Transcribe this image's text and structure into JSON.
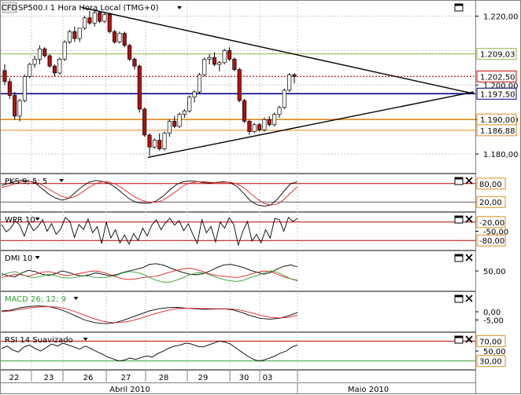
{
  "title": "SP500.I 1 Hora Hora Local (TMG+0)",
  "logo_text": "CFD",
  "colors": {
    "background": "#ffffff",
    "grid": "#c8c8c8",
    "candle_up": "#ffffff",
    "candle_down": "#b01010",
    "wick": "#000000",
    "green_level": "#8db840",
    "red_dotted": "#c00000",
    "blue_level": "#000090",
    "orange_level": "#e08a1a",
    "trendline": "#000000",
    "oscillator_black": "#000000",
    "oscillator_red": "#e02020",
    "oscillator_green": "#30a030",
    "box_orange": "#e08a1a"
  },
  "icons": {
    "window": "maximize-icon",
    "close": "close-icon",
    "dropdown": "dropdown-arrow-icon"
  },
  "main_panel": {
    "y_ticks": [
      "1.220,00",
      "1.200,00",
      "1.190,00",
      "1.180,00"
    ],
    "level_boxes": [
      {
        "name": "green",
        "label": "1.209,03",
        "value": 1209.03
      },
      {
        "name": "red",
        "label": "1.202,50",
        "value": 1202.5
      },
      {
        "name": "blue",
        "label": "1.197,50",
        "value": 1197.5
      },
      {
        "name": "orange1",
        "label": "1.190,00",
        "value": 1190.0
      },
      {
        "name": "orange2",
        "label": "1.186,88",
        "value": 1186.88
      }
    ]
  },
  "x_axis": {
    "day_labels": [
      "22",
      "23",
      "26",
      "27",
      "28",
      "29",
      "30",
      "03"
    ],
    "month_labels": [
      "Abril 2010",
      "Maio 2010"
    ]
  },
  "chart_data": [
    {
      "type": "candlestick",
      "title": "SP500.I 1 Hora Hora Local (TMG+0)",
      "ylim": [
        1175,
        1224
      ],
      "ohlc": [
        [
          1204.2,
          1206.0,
          1200.0,
          1201.0
        ],
        [
          1201.0,
          1202.0,
          1196.0,
          1197.0
        ],
        [
          1197.0,
          1198.0,
          1190.0,
          1191.0
        ],
        [
          1191.0,
          1196.0,
          1189.5,
          1195.5
        ],
        [
          1195.5,
          1203.0,
          1195.0,
          1202.5
        ],
        [
          1202.5,
          1206.5,
          1202.0,
          1206.0
        ],
        [
          1206.0,
          1208.5,
          1205.0,
          1207.5
        ],
        [
          1207.5,
          1211.5,
          1206.0,
          1210.5
        ],
        [
          1210.5,
          1211.0,
          1208.0,
          1208.5
        ],
        [
          1208.5,
          1209.0,
          1205.0,
          1205.5
        ],
        [
          1205.5,
          1206.0,
          1202.5,
          1203.5
        ],
        [
          1203.5,
          1208.0,
          1203.0,
          1207.5
        ],
        [
          1207.5,
          1213.0,
          1207.0,
          1212.5
        ],
        [
          1212.5,
          1216.0,
          1212.0,
          1215.5
        ],
        [
          1215.5,
          1217.0,
          1212.5,
          1213.5
        ],
        [
          1213.5,
          1216.5,
          1212.5,
          1216.5
        ],
        [
          1216.5,
          1220.0,
          1216.0,
          1219.5
        ],
        [
          1219.5,
          1221.5,
          1217.5,
          1218.0
        ],
        [
          1218.0,
          1221.5,
          1217.0,
          1221.0
        ],
        [
          1221.0,
          1221.5,
          1218.0,
          1218.5
        ],
        [
          1218.5,
          1221.0,
          1218.0,
          1220.5
        ],
        [
          1220.5,
          1221.0,
          1215.0,
          1215.5
        ],
        [
          1215.5,
          1216.0,
          1212.0,
          1212.5
        ],
        [
          1212.5,
          1215.5,
          1212.0,
          1215.0
        ],
        [
          1215.0,
          1215.5,
          1211.0,
          1211.5
        ],
        [
          1211.5,
          1212.0,
          1207.0,
          1207.5
        ],
        [
          1207.5,
          1208.0,
          1204.5,
          1205.5
        ],
        [
          1205.5,
          1206.0,
          1192.0,
          1193.0
        ],
        [
          1193.0,
          1193.5,
          1185.0,
          1185.5
        ],
        [
          1185.5,
          1186.0,
          1179.5,
          1182.0
        ],
        [
          1182.0,
          1184.5,
          1181.5,
          1184.0
        ],
        [
          1184.0,
          1186.0,
          1181.0,
          1181.5
        ],
        [
          1181.5,
          1186.5,
          1181.0,
          1186.0
        ],
        [
          1186.0,
          1190.0,
          1185.0,
          1189.5
        ],
        [
          1189.5,
          1191.0,
          1187.5,
          1188.0
        ],
        [
          1188.0,
          1192.0,
          1187.5,
          1191.5
        ],
        [
          1191.5,
          1193.0,
          1190.5,
          1192.5
        ],
        [
          1192.5,
          1197.0,
          1192.0,
          1196.5
        ],
        [
          1196.5,
          1198.5,
          1195.0,
          1198.0
        ],
        [
          1198.0,
          1203.5,
          1197.5,
          1203.0
        ],
        [
          1203.0,
          1208.0,
          1202.5,
          1207.5
        ],
        [
          1207.5,
          1209.0,
          1206.0,
          1208.0
        ],
        [
          1208.0,
          1209.5,
          1205.5,
          1206.0
        ],
        [
          1206.0,
          1207.0,
          1204.0,
          1206.5
        ],
        [
          1206.5,
          1210.5,
          1206.0,
          1210.0
        ],
        [
          1210.0,
          1211.0,
          1207.0,
          1207.5
        ],
        [
          1207.5,
          1208.0,
          1204.0,
          1204.5
        ],
        [
          1204.5,
          1205.0,
          1195.0,
          1195.5
        ],
        [
          1195.5,
          1196.0,
          1189.0,
          1189.5
        ],
        [
          1189.5,
          1190.0,
          1185.5,
          1186.5
        ],
        [
          1186.5,
          1189.0,
          1186.0,
          1188.5
        ],
        [
          1188.5,
          1189.0,
          1186.5,
          1187.0
        ],
        [
          1187.0,
          1190.5,
          1186.5,
          1190.0
        ],
        [
          1190.0,
          1191.0,
          1188.0,
          1188.5
        ],
        [
          1188.5,
          1192.0,
          1188.0,
          1191.5
        ],
        [
          1191.5,
          1194.0,
          1190.5,
          1193.5
        ],
        [
          1193.5,
          1199.0,
          1193.0,
          1198.5
        ],
        [
          1198.5,
          1203.5,
          1198.0,
          1203.0
        ],
        [
          1203.0,
          1203.5,
          1200.5,
          1202.5
        ]
      ],
      "horizontal_levels": [
        1209.03,
        1202.5,
        1197.5,
        1190.0,
        1186.88
      ],
      "trendlines": [
        {
          "from": [
            0.17,
            1222.5
          ],
          "to": [
            1.0,
            1197.5
          ]
        },
        {
          "from": [
            0.31,
            1179.0
          ],
          "to": [
            1.0,
            1198.0
          ]
        }
      ]
    },
    {
      "type": "line",
      "title": "PKS 9; 5; 5",
      "ylim": [
        0,
        100
      ],
      "y_ticks": [],
      "levels": [
        {
          "label": "80,00",
          "value": 80
        },
        {
          "label": "20,00",
          "value": 20
        }
      ],
      "series": [
        {
          "color": "black",
          "values": [
            74,
            80,
            87,
            91,
            88,
            82,
            64,
            46,
            33,
            26,
            32,
            52,
            70,
            85,
            90,
            87,
            80,
            67,
            48,
            30,
            19,
            16,
            16,
            23,
            39,
            59,
            77,
            86,
            89,
            87,
            83,
            82,
            84,
            86,
            83,
            71,
            48,
            24,
            11,
            6,
            10,
            29,
            56,
            80,
            86
          ]
        },
        {
          "color": "red",
          "values": [
            68,
            72,
            80,
            85,
            87,
            85,
            76,
            62,
            49,
            38,
            32,
            38,
            52,
            68,
            80,
            86,
            85,
            78,
            64,
            48,
            34,
            24,
            19,
            19,
            26,
            40,
            56,
            72,
            82,
            86,
            86,
            84,
            83,
            84,
            84,
            79,
            67,
            48,
            30,
            16,
            10,
            13,
            28,
            50,
            70
          ]
        }
      ]
    },
    {
      "type": "line",
      "title": "WPR 10",
      "ylim": [
        -100,
        0
      ],
      "y_ticks": [
        "-50,00"
      ],
      "levels": [
        {
          "label": "-20,00",
          "value": -20
        },
        {
          "label": "-80,00",
          "value": -80
        }
      ],
      "series": [
        {
          "color": "black",
          "values": [
            -28,
            -52,
            -40,
            -15,
            -30,
            -66,
            -22,
            -48,
            -35,
            -12,
            -50,
            -25,
            -60,
            -42,
            -5,
            -18,
            -70,
            -28,
            -44,
            -10,
            -55,
            -35,
            -90,
            -20,
            -72,
            -45,
            -88,
            -62,
            -92,
            -58,
            -80,
            -40,
            -65,
            -30,
            -12,
            -45,
            -22,
            -8,
            -30,
            -15,
            -48,
            -25,
            -60,
            -90,
            -12,
            -55,
            -34,
            -85,
            -20,
            -40,
            -6,
            -28,
            -95,
            -50,
            -18,
            -82,
            -60,
            -88,
            -45,
            -72,
            -8,
            -12,
            -50,
            -5,
            -18,
            -8
          ]
        }
      ]
    },
    {
      "type": "line",
      "title": "DMI 10",
      "ylim": [
        0,
        100
      ],
      "y_ticks": [
        "50,00"
      ],
      "series": [
        {
          "color": "black",
          "values": [
            42,
            35,
            32,
            44,
            52,
            48,
            40,
            36,
            42,
            50,
            45,
            38,
            34,
            38,
            44,
            40,
            36,
            38,
            45,
            50,
            55,
            60,
            70,
            72,
            68,
            60,
            52,
            45,
            40,
            38,
            42,
            50,
            60,
            68,
            70,
            66,
            60,
            52,
            46,
            40,
            45,
            56,
            64,
            68,
            62
          ]
        },
        {
          "color": "red",
          "values": [
            30,
            34,
            40,
            38,
            34,
            40,
            46,
            48,
            44,
            38,
            36,
            40,
            44,
            48,
            50,
            46,
            40,
            32,
            26,
            24,
            26,
            30,
            32,
            34,
            40,
            46,
            52,
            56,
            58,
            54,
            48,
            40,
            36,
            34,
            32,
            30,
            34,
            40,
            46,
            50,
            48,
            40,
            32,
            26,
            22
          ]
        },
        {
          "color": "green",
          "values": [
            36,
            44,
            48,
            40,
            32,
            30,
            34,
            40,
            36,
            30,
            28,
            30,
            36,
            34,
            30,
            30,
            32,
            36,
            44,
            48,
            46,
            40,
            30,
            22,
            16,
            16,
            22,
            30,
            38,
            44,
            44,
            38,
            30,
            24,
            20,
            18,
            22,
            30,
            36,
            44,
            50,
            46,
            36,
            26,
            20
          ]
        }
      ]
    },
    {
      "type": "line",
      "title": "MACD 26; 12; 9",
      "ylim": [
        -10,
        10
      ],
      "y_ticks": [
        "0,00",
        "-5,00"
      ],
      "series": [
        {
          "color": "black",
          "values": [
            0.5,
            1.0,
            2.4,
            3.2,
            3.5,
            3.2,
            2.0,
            0.0,
            -2.5,
            -5.0,
            -6.5,
            -7.2,
            -7.0,
            -5.5,
            -3.5,
            -1.5,
            0.5,
            1.8,
            2.5,
            2.6,
            2.2,
            1.8,
            1.5,
            1.6,
            1.8,
            1.2,
            -0.5,
            -2.5,
            -4.0,
            -4.5,
            -4.0,
            -2.5,
            -0.5
          ]
        },
        {
          "color": "red",
          "values": [
            0.0,
            0.5,
            1.5,
            2.3,
            2.9,
            3.1,
            2.8,
            1.8,
            0.0,
            -2.2,
            -4.2,
            -5.8,
            -6.6,
            -6.5,
            -5.5,
            -4.0,
            -2.2,
            -0.5,
            0.9,
            1.8,
            2.2,
            2.1,
            1.9,
            1.8,
            1.8,
            1.6,
            0.8,
            -0.6,
            -2.2,
            -3.4,
            -3.8,
            -3.4,
            -2.2
          ]
        }
      ]
    },
    {
      "type": "line",
      "title": "RSI 14 Suavizado",
      "ylim": [
        20,
        80
      ],
      "y_ticks": [
        "50,00"
      ],
      "levels": [
        {
          "label": "70,00",
          "value": 70
        },
        {
          "label": "30,00",
          "value": 30
        }
      ],
      "series": [
        {
          "color": "black",
          "values": [
            55,
            60,
            52,
            48,
            58,
            62,
            55,
            50,
            57,
            64,
            60,
            66,
            62,
            58,
            54,
            60,
            55,
            49,
            44,
            38,
            34,
            30,
            32,
            36,
            33,
            37,
            40,
            38,
            45,
            50,
            56,
            60,
            62,
            66,
            64,
            60,
            58,
            62,
            66,
            70,
            68,
            64,
            56,
            48,
            40,
            34,
            30,
            32,
            36,
            40,
            46,
            50,
            58,
            62
          ]
        }
      ]
    }
  ]
}
